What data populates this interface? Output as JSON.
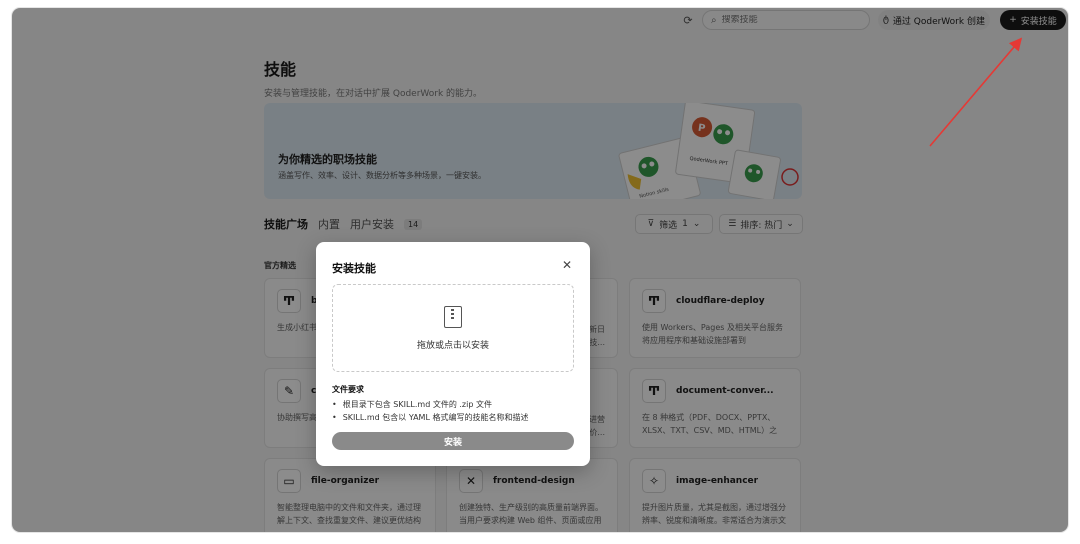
{
  "topbar": {
    "search_placeholder": "搜索技能",
    "create_via_label": "通过 QoderWork 创建",
    "install_label": "安装技能"
  },
  "page": {
    "title": "技能",
    "subtitle": "安装与管理技能，在对话中扩展 QoderWork 的能力。"
  },
  "banner": {
    "title": "为你精选的职场技能",
    "subtitle": "涵盖写作、效率、设计、数据分析等多种场景，一键安装。"
  },
  "tabs": [
    {
      "label": "技能广场"
    },
    {
      "label": "内置"
    },
    {
      "label": "用户安装"
    }
  ],
  "user_install_count": "14",
  "filter": {
    "label": "筛选",
    "count": "1"
  },
  "sort": {
    "label": "排序: 热门"
  },
  "section_label": "官方精选",
  "cards": [
    {
      "name": "b",
      "desc": "生成小红书格和 8 种布"
    },
    {
      "name": "cloudflare-deploy",
      "desc": "使用 Workers、Pages 及相关平台服务将应用程序和基础设施部署到 Cloudflare。..."
    },
    {
      "name": "c",
      "desc": "协助撰写高引用、改进"
    },
    {
      "name": "document-conver...",
      "desc": "在 8 种格式（PDF、DOCX、PPTX、XLSX、TXT、CSV、MD、HTML）之间..."
    },
    {
      "name": "file-organizer",
      "desc": "智能整理电脑中的文件和文件夹，通过理解上下文、查找重复文件、建议更优结构并..."
    },
    {
      "name": "frontend-design",
      "desc": "创建独特、生产级别的高质量前端界面。当用户要求构建 Web 组件、页面或应用程..."
    },
    {
      "name": "image-enhancer",
      "desc": "提升图片质量，尤其是截图，通过增强分辨率、锐度和清晰度。非常适合为演示文稿..."
    }
  ],
  "card_partials": [
    "新日",
    "技...",
    "进营",
    "价..."
  ],
  "modal": {
    "title": "安装技能",
    "dropzone_text": "拖放或点击以安装",
    "requirements_title": "文件要求",
    "requirements": [
      "根目录下包含 SKILL.md 文件的 .zip 文件",
      "SKILL.md 包含以 YAML 格式编写的技能名称和描述"
    ],
    "install_button": "安装"
  },
  "banner_art_texts": [
    "QoderWork PPT",
    "Notion skills"
  ],
  "colors": {
    "accent_arrow": "#e53935",
    "primary_dark": "#1a1a1a",
    "banner_bg": "#ddeaf3"
  }
}
